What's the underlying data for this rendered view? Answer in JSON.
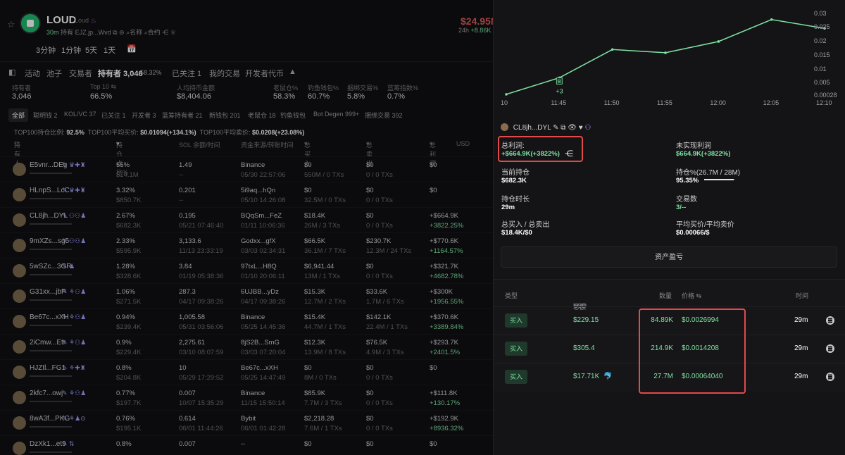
{
  "token": {
    "name": "LOUD",
    "subtitle": "Loud",
    "meta_age": "30m",
    "meta_holder_label": "持有",
    "meta_address": "EJZ.jp...Wvd",
    "name_label": "名称",
    "contract_label": "合约",
    "price": "$24.95M",
    "price_change_label": "24h",
    "price_change": "+8.86K"
  },
  "timeframes": [
    "3分钟",
    "1分钟",
    "5天",
    "1天"
  ],
  "tabs": [
    "活动",
    "池子",
    "交易者",
    "持有者 3,046",
    "58.32%",
    "已关注 1",
    "我的交易",
    "开发者代币"
  ],
  "stats": [
    {
      "label": "持有者",
      "value": "3,046"
    },
    {
      "label": "Top 10 ⇆",
      "value": "66.5%"
    },
    {
      "label": "人均持币金额",
      "value": "$8,404.06"
    },
    {
      "label": "老鼠仓%",
      "value": "58.3%"
    },
    {
      "label": "钓鱼钱包%",
      "value": "60.7%"
    },
    {
      "label": "捆绑交易%",
      "value": "5.8%"
    },
    {
      "label": "蓝筹指数%",
      "value": "0.7%"
    }
  ],
  "filter_tabs": [
    "全部",
    "聪明钱 2",
    "KOL/VC 37",
    "已关注 1",
    "开发者 3",
    "蓝筹持有者 21",
    "新钱包 201",
    "老鼠仓 18",
    "钓鱼钱包",
    "Bot Degen 999+",
    "捆绑交易 392"
  ],
  "top100": {
    "hold_label": "TOP100持仓比例:",
    "hold_value": "92.5%",
    "buy_label": "TOP100平均买价:",
    "buy_value": "$0.01094(+134.1%)",
    "sell_label": "TOP100平均卖价:",
    "sell_value": "$0.0208(+23.08%)"
  },
  "holders_header": {
    "holder": "持有人",
    "ratio": "持仓占比%",
    "sol": "SOL 余额/时间",
    "source": "资金来源/转账时间",
    "total_buy": "总买入",
    "total_sell": "总卖出",
    "total_pnl": "总利润",
    "currency": "USD"
  },
  "holders": [
    {
      "name": "E5vnr...DEg",
      "pct": "55%",
      "usd": "$14.1M",
      "sol": "1.49",
      "sol_time": "--",
      "src": "Binance",
      "src_time": "05/30 22:57:06",
      "buy": "$0",
      "buy_tx": "550M / 0 TXs",
      "sell": "$0",
      "sell_tx": "0 / 0 TXs",
      "pnl": "$0",
      "pnl_pct": ""
    },
    {
      "name": "HLnpS...LcC",
      "pct": "3.32%",
      "usd": "$850.7K",
      "sol": "0.201",
      "sol_time": "--",
      "src": "5i9aq...hQn",
      "src_time": "05/10 14:26:08",
      "buy": "$0",
      "buy_tx": "32.5M / 0 TXs",
      "sell": "$0",
      "sell_tx": "0 / 0 TXs",
      "pnl": "$0",
      "pnl_pct": ""
    },
    {
      "name": "CL8jh...DYL",
      "pct": "2.67%",
      "usd": "$682.3K",
      "sol": "0.195",
      "sol_time": "05/21 07:46:40",
      "src": "BQqSm...FeZ",
      "src_time": "01/11 10:06:36",
      "buy": "$18.4K",
      "buy_tx": "26M / 3 TXs",
      "sell": "$0",
      "sell_tx": "0 / 0 TXs",
      "pnl": "+$664.9K",
      "pnl_pct": "+3822.25%"
    },
    {
      "name": "9mXZs...sg5",
      "pct": "2.33%",
      "usd": "$595.9K",
      "sol": "3,133.6",
      "sol_time": "11/13 23:33:19",
      "src": "Godxx...gfX",
      "src_time": "03/03 02:34:31",
      "buy": "$66.5K",
      "buy_tx": "36.1M / 7 TXs",
      "sell": "$230.7K",
      "sell_tx": "12.3M / 24 TXs",
      "pnl": "+$770.6K",
      "pnl_pct": "+1164.57%"
    },
    {
      "name": "5wSZc...3GR",
      "pct": "1.28%",
      "usd": "$328.6K",
      "sol": "3.84",
      "sol_time": "01/19 05:38:36",
      "src": "97txL...H8Q",
      "src_time": "01/10 20:06:11",
      "buy": "$6,941.44",
      "buy_tx": "13M / 1 TXs",
      "sell": "$0",
      "sell_tx": "0 / 0 TXs",
      "pnl": "+$321.7K",
      "pnl_pct": "+4682.78%"
    },
    {
      "name": "G31xx...jbP",
      "pct": "1.06%",
      "usd": "$271.5K",
      "sol": "287.3",
      "sol_time": "04/17 09:38:26",
      "src": "6UJBB...yDz",
      "src_time": "04/17 09:38:26",
      "buy": "$15.3K",
      "buy_tx": "12.7M / 2 TXs",
      "sell": "$33.6K",
      "sell_tx": "1.7M / 6 TXs",
      "pnl": "+$300K",
      "pnl_pct": "+1956.55%"
    },
    {
      "name": "Be67c...xXH",
      "pct": "0.94%",
      "usd": "$239.4K",
      "sol": "1,005.58",
      "sol_time": "05/31 03:56:06",
      "src": "Binance",
      "src_time": "05/25 14:45:36",
      "buy": "$15.4K",
      "buy_tx": "44.7M / 1 TXs",
      "sell": "$142.1K",
      "sell_tx": "22.4M / 1 TXs",
      "pnl": "+$370.6K",
      "pnl_pct": "+3389.84%"
    },
    {
      "name": "2iCmw...Etr",
      "pct": "0.9%",
      "usd": "$229.4K",
      "sol": "2,275.61",
      "sol_time": "03/10 08:07:59",
      "src": "8jS2B...SmG",
      "src_time": "03/03 07:20:04",
      "buy": "$12.3K",
      "buy_tx": "13.9M / 8 TXs",
      "sell": "$76.5K",
      "sell_tx": "4.9M / 3 TXs",
      "pnl": "+$293.7K",
      "pnl_pct": "+2401.5%"
    },
    {
      "name": "HJZtl...FG1",
      "pct": "0.8%",
      "usd": "$204.8K",
      "sol": "10",
      "sol_time": "05/29 17:29:52",
      "src": "Be67c...xXH",
      "src_time": "05/25 14:47:49",
      "buy": "$0",
      "buy_tx": "8M / 0 TXs",
      "sell": "$0",
      "sell_tx": "0 / 0 TXs",
      "pnl": "$0",
      "pnl_pct": ""
    },
    {
      "name": "2kfc7...owj",
      "pct": "0.77%",
      "usd": "$197.7K",
      "sol": "0.007",
      "sol_time": "10/07 15:35:29",
      "src": "Binance",
      "src_time": "11/15 15:50:14",
      "buy": "$85.9K",
      "buy_tx": "7.7M / 3 TXs",
      "sell": "$0",
      "sell_tx": "0 / 0 TXs",
      "pnl": "+$111.8K",
      "pnl_pct": "+130.17%"
    },
    {
      "name": "8wA3f...PKG",
      "pct": "0.76%",
      "usd": "$195.1K",
      "sol": "0.614",
      "sol_time": "06/01 11:44:26",
      "src": "Bybit",
      "src_time": "06/01 01:42:28",
      "buy": "$2,218.28",
      "buy_tx": "7.6M / 1 TXs",
      "sell": "$0",
      "sell_tx": "0 / 0 TXs",
      "pnl": "+$192.9K",
      "pnl_pct": "+8936.32%"
    },
    {
      "name": "DzXk1...et9",
      "pct": "0.8%",
      "usd": "",
      "sol": "0.007",
      "sol_time": "",
      "src": "--",
      "src_time": "",
      "buy": "$0",
      "buy_tx": "",
      "sell": "$0",
      "sell_tx": "",
      "pnl": "$0",
      "pnl_pct": ""
    }
  ],
  "chart_data": {
    "type": "line",
    "x": [
      "11:40",
      "11:45",
      "11:50",
      "11:55",
      "12:00",
      "12:05",
      "12:10"
    ],
    "x_tick_labels": [
      "10",
      "11:45",
      "11:50",
      "11:55",
      "12:00",
      "12:05",
      "12:10"
    ],
    "series": [
      {
        "values": [
          0.00028,
          0.0063,
          0.0166,
          0.0154,
          0.0195,
          0.0275,
          0.0243
        ]
      }
    ],
    "y_ticks": [
      "0.03",
      "0.025",
      "0.02",
      "0.015",
      "0.01",
      "0.005",
      "0.00028"
    ],
    "ylim": [
      0,
      0.03
    ],
    "annotation": {
      "text": "+3",
      "x": "11:45",
      "marker": "B"
    },
    "color": "#7ee2a2"
  },
  "wallet": {
    "name": "CL8jh...DYL",
    "total_pnl_label": "总利润:",
    "total_pnl_value": "+$664.9K(+3822%)",
    "unrealized_label": "未实现利润",
    "unrealized_value": "$664.9K(+3822%)",
    "holding_label": "当前持仓",
    "holding_value": "$682.3K",
    "holding_pct_label": "持仓%(26.7M / 28M)",
    "holding_pct_value": "95.35%",
    "holding_pct_fraction": 0.9535,
    "hold_time_label": "持仓时长",
    "hold_time_value": "29m",
    "tx_count_label": "交易数",
    "tx_count_value": "3/--",
    "buy_sell_label": "总买入 / 总卖出",
    "buy_sell_value": "$18.4K/$0",
    "avg_price_label": "平均买价/平均卖价",
    "avg_price_value": "$0.00066/$",
    "assets_button": "资产盈亏"
  },
  "transactions": {
    "header": {
      "type": "类型",
      "total": "总额",
      "currency": "USD",
      "amount": "数量",
      "price": "价格 ⇆",
      "time": "时间"
    },
    "rows": [
      {
        "type": "买入",
        "total": "$229.15",
        "amount": "84.89K",
        "price": "$0.0026994",
        "time": "29m"
      },
      {
        "type": "买入",
        "total": "$305.4",
        "amount": "214.9K",
        "price": "$0.0014208",
        "time": "29m"
      },
      {
        "type": "买入",
        "total": "$17.71K",
        "amount": "27.7M",
        "price": "$0.00064040",
        "time": "29m"
      }
    ]
  },
  "colors": {
    "accent": "#7ee2a2",
    "negative": "#e05a5a",
    "highlight": "#e24a4a",
    "background": "#0d0d0f"
  }
}
